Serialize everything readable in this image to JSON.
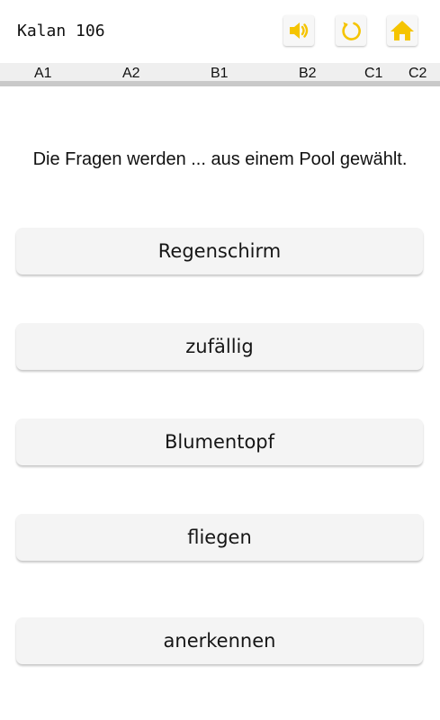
{
  "header": {
    "remaining_text": "Kalan 106",
    "icons": [
      "speaker-icon",
      "refresh-icon",
      "home-icon"
    ],
    "accent_color": "#f5c400"
  },
  "levels": [
    "A1",
    "A2",
    "B1",
    "B2",
    "C1",
    "C2"
  ],
  "question": "Die Fragen werden ... aus einem Pool gewählt.",
  "answers": [
    "Regenschirm",
    "zufällig",
    "Blumentopf",
    "fliegen",
    "anerkennen"
  ]
}
